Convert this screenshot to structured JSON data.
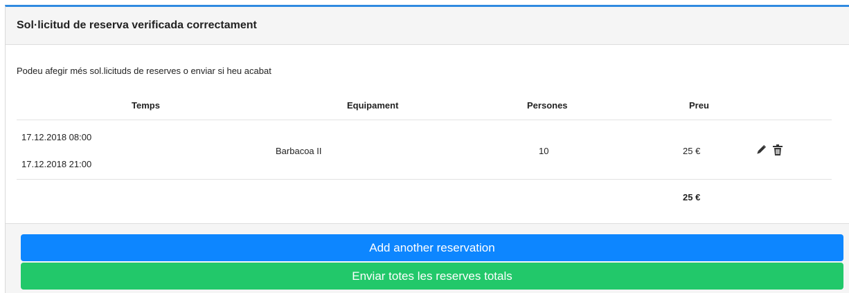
{
  "panel": {
    "title": "Sol·licitud de reserva verificada correctament",
    "intro": "Podeu afegir més sol.licituds de reserves o enviar si heu acabat"
  },
  "table": {
    "headers": {
      "time": "Temps",
      "equipment": "Equipament",
      "persons": "Persones",
      "price": "Preu"
    },
    "rows": [
      {
        "start": "17.12.2018 08:00",
        "end": "17.12.2018 21:00",
        "equipment": "Barbacoa II",
        "persons": "10",
        "price": "25 €",
        "edit_icon": "pencil-icon",
        "delete_icon": "trash-icon"
      }
    ],
    "total": "25 €"
  },
  "actions": {
    "add_label": "Add another reservation",
    "send_label": "Enviar totes les reserves totals"
  },
  "colors": {
    "accent_top": "#2f8ae0",
    "add_button": "#0d86ff",
    "send_button": "#22c86a"
  }
}
